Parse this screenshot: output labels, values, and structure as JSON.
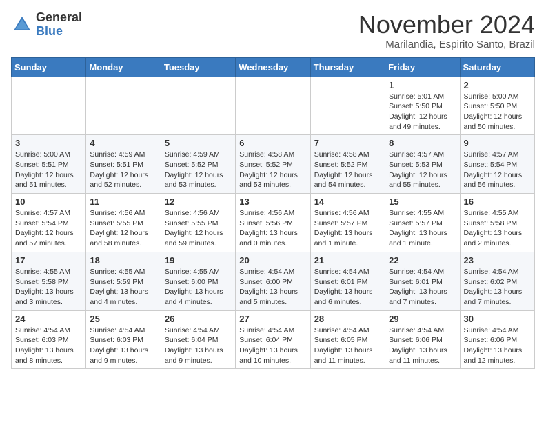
{
  "header": {
    "logo_general": "General",
    "logo_blue": "Blue",
    "month_title": "November 2024",
    "location": "Marilandia, Espirito Santo, Brazil"
  },
  "weekdays": [
    "Sunday",
    "Monday",
    "Tuesday",
    "Wednesday",
    "Thursday",
    "Friday",
    "Saturday"
  ],
  "weeks": [
    [
      {
        "day": "",
        "info": ""
      },
      {
        "day": "",
        "info": ""
      },
      {
        "day": "",
        "info": ""
      },
      {
        "day": "",
        "info": ""
      },
      {
        "day": "",
        "info": ""
      },
      {
        "day": "1",
        "info": "Sunrise: 5:01 AM\nSunset: 5:50 PM\nDaylight: 12 hours\nand 49 minutes."
      },
      {
        "day": "2",
        "info": "Sunrise: 5:00 AM\nSunset: 5:50 PM\nDaylight: 12 hours\nand 50 minutes."
      }
    ],
    [
      {
        "day": "3",
        "info": "Sunrise: 5:00 AM\nSunset: 5:51 PM\nDaylight: 12 hours\nand 51 minutes."
      },
      {
        "day": "4",
        "info": "Sunrise: 4:59 AM\nSunset: 5:51 PM\nDaylight: 12 hours\nand 52 minutes."
      },
      {
        "day": "5",
        "info": "Sunrise: 4:59 AM\nSunset: 5:52 PM\nDaylight: 12 hours\nand 53 minutes."
      },
      {
        "day": "6",
        "info": "Sunrise: 4:58 AM\nSunset: 5:52 PM\nDaylight: 12 hours\nand 53 minutes."
      },
      {
        "day": "7",
        "info": "Sunrise: 4:58 AM\nSunset: 5:52 PM\nDaylight: 12 hours\nand 54 minutes."
      },
      {
        "day": "8",
        "info": "Sunrise: 4:57 AM\nSunset: 5:53 PM\nDaylight: 12 hours\nand 55 minutes."
      },
      {
        "day": "9",
        "info": "Sunrise: 4:57 AM\nSunset: 5:54 PM\nDaylight: 12 hours\nand 56 minutes."
      }
    ],
    [
      {
        "day": "10",
        "info": "Sunrise: 4:57 AM\nSunset: 5:54 PM\nDaylight: 12 hours\nand 57 minutes."
      },
      {
        "day": "11",
        "info": "Sunrise: 4:56 AM\nSunset: 5:55 PM\nDaylight: 12 hours\nand 58 minutes."
      },
      {
        "day": "12",
        "info": "Sunrise: 4:56 AM\nSunset: 5:55 PM\nDaylight: 12 hours\nand 59 minutes."
      },
      {
        "day": "13",
        "info": "Sunrise: 4:56 AM\nSunset: 5:56 PM\nDaylight: 13 hours\nand 0 minutes."
      },
      {
        "day": "14",
        "info": "Sunrise: 4:56 AM\nSunset: 5:57 PM\nDaylight: 13 hours\nand 1 minute."
      },
      {
        "day": "15",
        "info": "Sunrise: 4:55 AM\nSunset: 5:57 PM\nDaylight: 13 hours\nand 1 minute."
      },
      {
        "day": "16",
        "info": "Sunrise: 4:55 AM\nSunset: 5:58 PM\nDaylight: 13 hours\nand 2 minutes."
      }
    ],
    [
      {
        "day": "17",
        "info": "Sunrise: 4:55 AM\nSunset: 5:58 PM\nDaylight: 13 hours\nand 3 minutes."
      },
      {
        "day": "18",
        "info": "Sunrise: 4:55 AM\nSunset: 5:59 PM\nDaylight: 13 hours\nand 4 minutes."
      },
      {
        "day": "19",
        "info": "Sunrise: 4:55 AM\nSunset: 6:00 PM\nDaylight: 13 hours\nand 4 minutes."
      },
      {
        "day": "20",
        "info": "Sunrise: 4:54 AM\nSunset: 6:00 PM\nDaylight: 13 hours\nand 5 minutes."
      },
      {
        "day": "21",
        "info": "Sunrise: 4:54 AM\nSunset: 6:01 PM\nDaylight: 13 hours\nand 6 minutes."
      },
      {
        "day": "22",
        "info": "Sunrise: 4:54 AM\nSunset: 6:01 PM\nDaylight: 13 hours\nand 7 minutes."
      },
      {
        "day": "23",
        "info": "Sunrise: 4:54 AM\nSunset: 6:02 PM\nDaylight: 13 hours\nand 7 minutes."
      }
    ],
    [
      {
        "day": "24",
        "info": "Sunrise: 4:54 AM\nSunset: 6:03 PM\nDaylight: 13 hours\nand 8 minutes."
      },
      {
        "day": "25",
        "info": "Sunrise: 4:54 AM\nSunset: 6:03 PM\nDaylight: 13 hours\nand 9 minutes."
      },
      {
        "day": "26",
        "info": "Sunrise: 4:54 AM\nSunset: 6:04 PM\nDaylight: 13 hours\nand 9 minutes."
      },
      {
        "day": "27",
        "info": "Sunrise: 4:54 AM\nSunset: 6:04 PM\nDaylight: 13 hours\nand 10 minutes."
      },
      {
        "day": "28",
        "info": "Sunrise: 4:54 AM\nSunset: 6:05 PM\nDaylight: 13 hours\nand 11 minutes."
      },
      {
        "day": "29",
        "info": "Sunrise: 4:54 AM\nSunset: 6:06 PM\nDaylight: 13 hours\nand 11 minutes."
      },
      {
        "day": "30",
        "info": "Sunrise: 4:54 AM\nSunset: 6:06 PM\nDaylight: 13 hours\nand 12 minutes."
      }
    ]
  ]
}
